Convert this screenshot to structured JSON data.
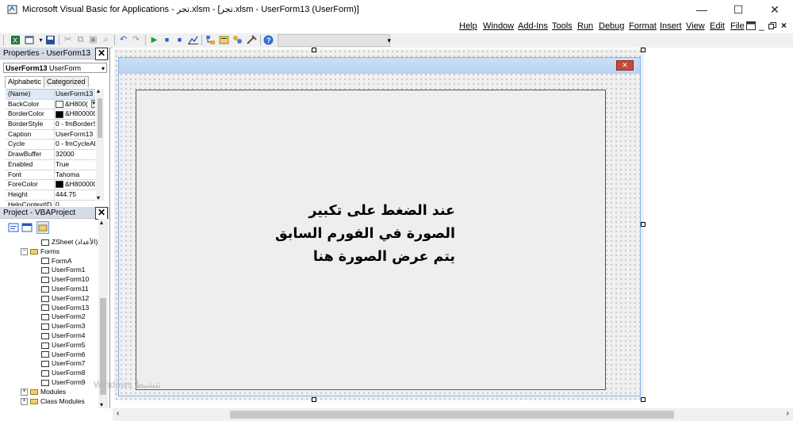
{
  "window": {
    "title": "Microsoft Visual Basic for Applications - تجر.xlsm - [تجر.xlsm - UserForm13 (UserForm)]",
    "minimize": "—",
    "maximize": "☐",
    "close": "✕"
  },
  "menubar": {
    "items": [
      "Help",
      "Window",
      "Add-Ins",
      "Tools",
      "Run",
      "Debug",
      "Format",
      "Insert",
      "View",
      "Edit",
      "File"
    ],
    "mdi_controls": [
      "_",
      "ð",
      "×"
    ]
  },
  "properties": {
    "title": "Properties - UserForm13",
    "object_name": "UserForm13",
    "object_type": "UserForm",
    "tabs": [
      "Alphabetic",
      "Categorized"
    ],
    "rows": [
      {
        "name": "(Name)",
        "value": "UserForm13"
      },
      {
        "name": "BackColor",
        "value": "&H800(",
        "swatch": "#ffffff",
        "dropdown": true
      },
      {
        "name": "BorderColor",
        "value": "&H800000",
        "swatch": "#000000"
      },
      {
        "name": "BorderStyle",
        "value": "0 - fmBorderSt"
      },
      {
        "name": "Caption",
        "value": "UserForm13"
      },
      {
        "name": "Cycle",
        "value": "0 - fmCycleAllF"
      },
      {
        "name": "DrawBuffer",
        "value": "32000"
      },
      {
        "name": "Enabled",
        "value": "True"
      },
      {
        "name": "Font",
        "value": "Tahoma"
      },
      {
        "name": "ForeColor",
        "value": "&H800000",
        "swatch": "#000000"
      },
      {
        "name": "Height",
        "value": "444.75"
      },
      {
        "name": "HelpContextID",
        "value": "0"
      }
    ]
  },
  "project": {
    "title": "Project - VBAProject",
    "tree": [
      {
        "label": "ZSheet (الأعداد)",
        "kind": "sheet",
        "indent": 1
      },
      {
        "label": "Forms",
        "kind": "folder-open",
        "indent": 0
      },
      {
        "label": "FormA",
        "kind": "form",
        "indent": 1
      },
      {
        "label": "UserForm1",
        "kind": "form",
        "indent": 1
      },
      {
        "label": "UserForm10",
        "kind": "form",
        "indent": 1
      },
      {
        "label": "UserForm11",
        "kind": "form",
        "indent": 1
      },
      {
        "label": "UserForm12",
        "kind": "form",
        "indent": 1
      },
      {
        "label": "UserForm13",
        "kind": "form",
        "indent": 1
      },
      {
        "label": "UserForm2",
        "kind": "form",
        "indent": 1
      },
      {
        "label": "UserForm3",
        "kind": "form",
        "indent": 1
      },
      {
        "label": "UserForm4",
        "kind": "form",
        "indent": 1
      },
      {
        "label": "UserForm5",
        "kind": "form",
        "indent": 1
      },
      {
        "label": "UserForm6",
        "kind": "form",
        "indent": 1
      },
      {
        "label": "UserForm7",
        "kind": "form",
        "indent": 1
      },
      {
        "label": "UserForm8",
        "kind": "form",
        "indent": 1
      },
      {
        "label": "UserForm9",
        "kind": "form",
        "indent": 1
      },
      {
        "label": "Modules",
        "kind": "folder",
        "indent": 0
      },
      {
        "label": "Class Modules",
        "kind": "folder",
        "indent": 0
      }
    ]
  },
  "form": {
    "text_lines": [
      "عند الضغط على تكبير",
      "الصورة في الفورم السابق",
      "يتم عرض الصورة هنا"
    ]
  },
  "watermark": "Windows تنشيط",
  "colors": {
    "panel_header": "#d6dbe9",
    "userform_titlebar": "#b7d2ee",
    "userform_close": "#c9483a"
  }
}
